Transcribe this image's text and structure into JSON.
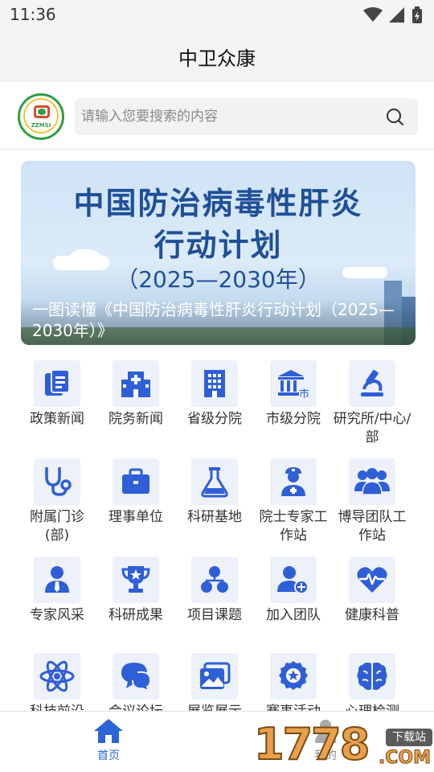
{
  "status_bar": {
    "time": "11:36"
  },
  "header": {
    "title": "中卫众康"
  },
  "logo": {
    "text": "ZZMSI"
  },
  "search": {
    "placeholder": "请输入您要搜索的内容"
  },
  "banner": {
    "headline_1": "中国防治病毒性肝炎",
    "headline_2": "行动计划",
    "headline_3": "（2025—2030年）",
    "caption": "一图读懂《中国防治病毒性肝炎行动计划（2025—2030年）》"
  },
  "grid": {
    "items": [
      {
        "label": "政策新闻",
        "icon": "document-icon"
      },
      {
        "label": "院务新闻",
        "icon": "hospital-icon"
      },
      {
        "label": "省级分院",
        "icon": "building-icon"
      },
      {
        "label": "市级分院",
        "icon": "city-hall-icon"
      },
      {
        "label": "研究所/中心/部",
        "icon": "microscope-icon"
      },
      {
        "label": "附属门诊(部)",
        "icon": "stethoscope-icon"
      },
      {
        "label": "理事单位",
        "icon": "briefcase-icon"
      },
      {
        "label": "科研基地",
        "icon": "flask-icon"
      },
      {
        "label": "院士专家工作站",
        "icon": "doctor-icon"
      },
      {
        "label": "博导团队工作站",
        "icon": "team-icon"
      },
      {
        "label": "专家风采",
        "icon": "expert-icon"
      },
      {
        "label": "科研成果",
        "icon": "trophy-icon"
      },
      {
        "label": "项目课题",
        "icon": "hierarchy-icon"
      },
      {
        "label": "加入团队",
        "icon": "add-user-icon"
      },
      {
        "label": "健康科普",
        "icon": "heart-pulse-icon"
      },
      {
        "label": "科技前沿",
        "icon": "atom-icon"
      },
      {
        "label": "会议论坛",
        "icon": "chat-icon"
      },
      {
        "label": "展览展示",
        "icon": "gallery-icon"
      },
      {
        "label": "赛事活动",
        "icon": "medal-icon"
      },
      {
        "label": "心理检测",
        "icon": "brain-icon"
      }
    ]
  },
  "bottom_nav": {
    "home_label": "首页",
    "mine_label": "我的"
  },
  "watermark": {
    "number": "1778",
    "tag": "下载站",
    "suffix": ".COM"
  },
  "colors": {
    "accent": "#2b66d8",
    "icon_blue": "#2f5fd6",
    "icon_bg": "#edf1fa"
  }
}
